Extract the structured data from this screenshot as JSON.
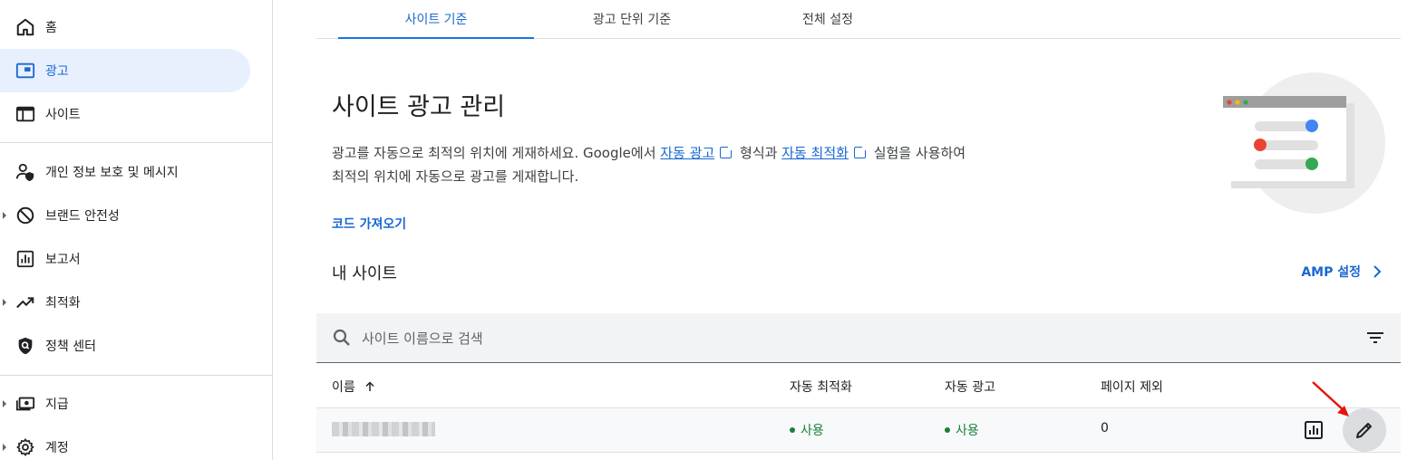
{
  "sidebar": {
    "items": [
      {
        "label": "홈",
        "icon": "home-icon"
      },
      {
        "label": "광고",
        "icon": "ads-icon",
        "active": true
      },
      {
        "label": "사이트",
        "icon": "sites-icon"
      },
      {
        "label": "개인 정보 보호 및 메시지",
        "icon": "privacy-icon"
      },
      {
        "label": "브랜드 안전성",
        "icon": "block-icon"
      },
      {
        "label": "보고서",
        "icon": "report-icon"
      },
      {
        "label": "최적화",
        "icon": "trending-icon"
      },
      {
        "label": "정책 센터",
        "icon": "policy-icon"
      },
      {
        "label": "지급",
        "icon": "payments-icon"
      },
      {
        "label": "계정",
        "icon": "gear-icon"
      }
    ]
  },
  "tabs": [
    {
      "label": "사이트 기준",
      "active": true
    },
    {
      "label": "광고 단위 기준"
    },
    {
      "label": "전체 설정"
    }
  ],
  "header": {
    "title": "사이트 광고 관리",
    "desc_part1": "광고를 자동으로 최적의 위치에 게재하세요. Google에서 ",
    "link_auto_ads": "자동 광고",
    "desc_part2": " 형식과 ",
    "link_auto_opt": "자동 최적화",
    "desc_part3": " 실험을 사용하여",
    "desc_line2": "최적의 위치에 자동으로 광고를 게재합니다.",
    "code_button": "코드 가져오기"
  },
  "sites": {
    "title": "내 사이트",
    "amp_label": "AMP 설정",
    "search_placeholder": "사이트 이름으로 검색",
    "columns": {
      "name": "이름",
      "auto_opt": "자동 최적화",
      "auto_ads": "자동 광고",
      "excluded": "페이지 제외"
    },
    "rows": [
      {
        "auto_opt": "사용",
        "auto_ads": "사용",
        "excluded": "0"
      }
    ]
  },
  "colors": {
    "accent": "#1967d2",
    "active_bg": "#e8f0fe",
    "status_green": "#188038",
    "annotation_arrow": "#e8130f"
  }
}
